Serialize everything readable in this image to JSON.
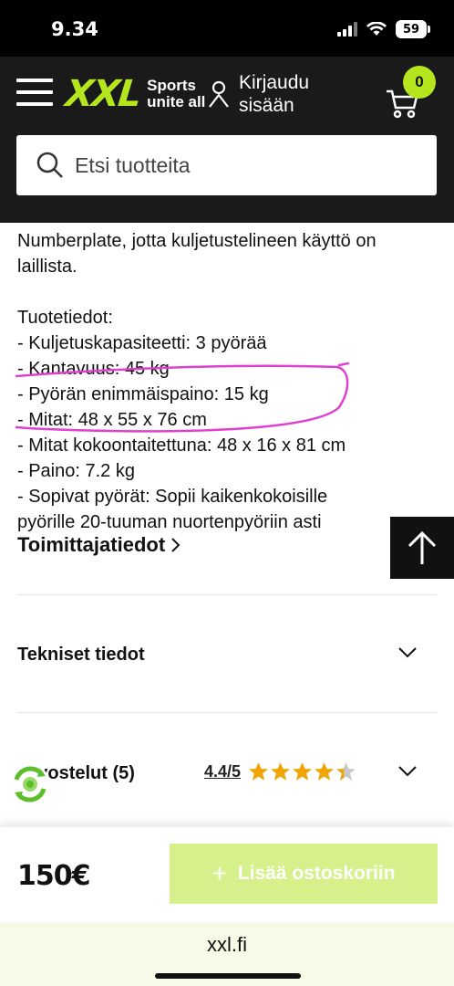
{
  "status_bar": {
    "time": "9.34",
    "battery": "59"
  },
  "header": {
    "logo": "XXL",
    "tagline_line1": "Sports",
    "tagline_line2": "unite all",
    "login_line1": "Kirjaudu",
    "login_line2": "sisään",
    "cart_count": "0",
    "search_placeholder": "Etsi tuotteita"
  },
  "description": {
    "partial_top": "Numberplate, jotta kuljetustelineen käyttö on",
    "partial_top_2": "laillista.",
    "specs_title": "Tuotetiedot:",
    "specs": [
      "- Kuljetuskapasiteetti: 3 pyörää",
      "- Kantavuus: 45 kg",
      "- Pyörän enimmäispaino: 15 kg",
      "- Mitat: 48 x 55 x 76 cm",
      "- Mitat kokoontaitettuna: 48 x 16 x 81 cm",
      "- Paino: 7.2 kg",
      "- Sopivat pyörät: Sopii kaikenkokoisille",
      "pyörille 20-tuuman nuortenpyöriin asti"
    ]
  },
  "supplier_link": "Toimittajatiedot",
  "accordions": {
    "tech": "Tekniset tiedot",
    "reviews": "Arvostelut (5)",
    "rating": "4.4/5"
  },
  "rating_value": 4.4,
  "bottom_bar": {
    "price": "150€",
    "add_to_cart": "Lisää ostoskoriin"
  },
  "url_bar": {
    "domain": "xxl.fi"
  },
  "colors": {
    "brand_green": "#b5e61d",
    "button_disabled": "#d6f08c",
    "annotation": "#e040d0",
    "star": "#f0a500"
  },
  "icons": [
    "menu-icon",
    "user-icon",
    "cart-icon",
    "search-icon",
    "chevron-right-icon",
    "arrow-up-icon",
    "chevron-down-icon",
    "star-icon",
    "eco-recycle-icon",
    "plus-icon"
  ]
}
